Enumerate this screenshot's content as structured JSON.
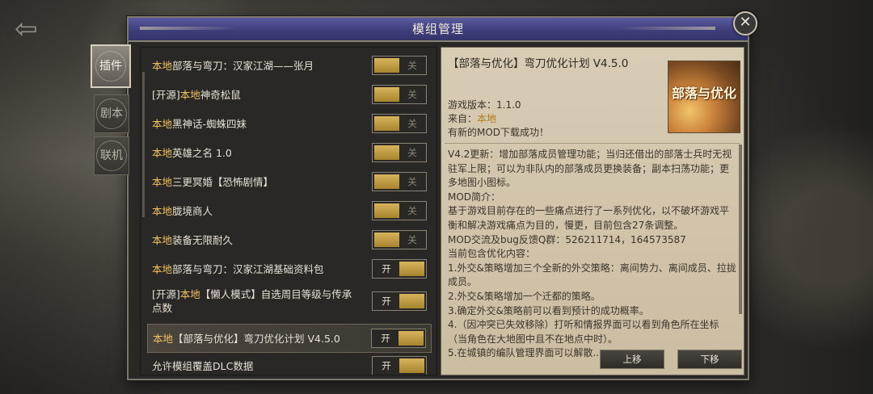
{
  "nav": {
    "back_icon": "back-arrow-icon"
  },
  "dialog": {
    "title": "模组管理",
    "close_icon": "close-icon",
    "side_tabs": [
      {
        "label": "插件",
        "active": true
      },
      {
        "label": "剧本",
        "active": false
      },
      {
        "label": "联机",
        "active": false
      }
    ]
  },
  "mods": [
    {
      "prefix": "",
      "src": "本地",
      "name": "部落与弯刀：汉家江湖——张月",
      "toggle": "关",
      "on": false,
      "selected": false
    },
    {
      "prefix": "[开源]",
      "src": "本地",
      "name": "神奇松鼠",
      "toggle": "关",
      "on": false,
      "selected": false
    },
    {
      "prefix": "",
      "src": "本地",
      "name": "黑神话-蜘蛛四妹",
      "toggle": "关",
      "on": false,
      "selected": false
    },
    {
      "prefix": "",
      "src": "本地",
      "name": "英雄之名 1.0",
      "toggle": "关",
      "on": false,
      "selected": false
    },
    {
      "prefix": "",
      "src": "本地",
      "name": "三更冥婚【恐怖剧情】",
      "toggle": "关",
      "on": false,
      "selected": false
    },
    {
      "prefix": "",
      "src": "本地",
      "name": "胧境商人",
      "toggle": "关",
      "on": false,
      "selected": false
    },
    {
      "prefix": "",
      "src": "本地",
      "name": "装备无限耐久",
      "toggle": "关",
      "on": false,
      "selected": false
    },
    {
      "prefix": "",
      "src": "本地",
      "name": "部落与弯刀：汉家江湖基础资料包",
      "toggle": "开",
      "on": true,
      "selected": false
    },
    {
      "prefix": "[开源]",
      "src": "本地",
      "name": "【懒人模式】自选周目等级与传承点数",
      "toggle": "开",
      "on": true,
      "selected": false
    },
    {
      "prefix": "",
      "src": "本地",
      "name": "【部落与优化】弯刀优化计划 V4.5.0",
      "toggle": "开",
      "on": true,
      "selected": true
    },
    {
      "prefix": "",
      "src": "",
      "name": "允许模组覆盖DLC数据",
      "toggle": "开",
      "on": true,
      "selected": false
    }
  ],
  "detail": {
    "title": "【部落与优化】弯刀优化计划 V4.5.0",
    "thumb_text": "部落与优化",
    "version_label": "游戏版本：",
    "version": "1.1.0",
    "from_label": "来自：",
    "from": "本地",
    "status": "有新的MOD下载成功！",
    "description": [
      "V4.2更新：增加部落成员管理功能；当归还借出的部落士兵时无视驻军上限；可以为非队内的部落成员更换装备；副本扫荡功能；更多地图小图标。",
      "MOD简介：",
      "基于游戏目前存在的一些痛点进行了一系列优化，以不破坏游戏平衡和解决游戏痛点为目的，慢更，目前包含27条调整。",
      "MOD交流及bug反馈Q群：526211714，164573587",
      "当前包含优化内容：",
      "1.外交&策略增加三个全新的外交策略：离间势力、离间成员、拉拢成员。",
      "2.外交&策略增加一个迁都的策略。",
      "3.确定外交&策略前可以看到预计的成功概率。",
      "4.（因冲突已失效移除）打听和情报界面可以看到角色所在坐标（当角色在大地图中且不在地点中时）。",
      "5.在城镇的编队管理界面可以解散..."
    ],
    "move_up": "上移",
    "move_down": "下移"
  },
  "colors": {
    "accent_gold": "#d6b35c",
    "source_orange": "#f0c060",
    "title_bar": "#3e3e7c"
  }
}
